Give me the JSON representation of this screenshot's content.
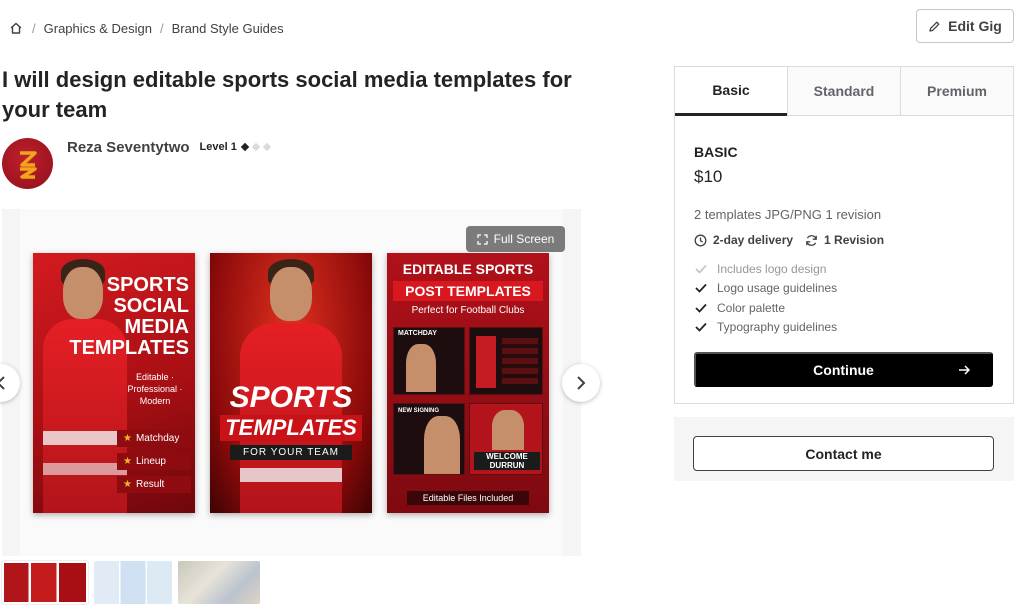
{
  "breadcrumb": {
    "home_icon": "home-icon",
    "items": [
      "Graphics & Design",
      "Brand Style Guides"
    ]
  },
  "actions": {
    "edit_gig": "Edit Gig"
  },
  "gig": {
    "title": "I will design editable sports social media templates for your team"
  },
  "seller": {
    "name": "Reza Seventytwo",
    "level": "Level 1"
  },
  "gallery": {
    "fullscreen_label": "Full Screen",
    "poster1": {
      "headline": [
        "SPORTS",
        "SOCIAL",
        "MEDIA",
        "TEMPLATES"
      ],
      "tagline": "Editable · Professional · Modern",
      "pills": [
        "Matchday",
        "Lineup",
        "Result"
      ]
    },
    "poster2": {
      "line1": "SPORTS",
      "line2": "TEMPLATES",
      "line3": "FOR YOUR TEAM"
    },
    "poster3": {
      "line1": "EDITABLE SPORTS",
      "line2": "POST TEMPLATES",
      "line3": "Perfect for Football Clubs",
      "tiles": [
        "MATCHDAY",
        "NEW SIGNING",
        "WELCOME DURRUN"
      ],
      "footer": "Editable Files Included"
    }
  },
  "package": {
    "tabs": [
      "Basic",
      "Standard",
      "Premium"
    ],
    "active_tab": "Basic",
    "name": "BASIC",
    "price": "$10",
    "description": "2 templates JPG/PNG 1 revision",
    "delivery": "2-day delivery",
    "revisions": "1 Revision",
    "features": [
      {
        "label": "Includes logo design",
        "included": false
      },
      {
        "label": "Logo usage guidelines",
        "included": true
      },
      {
        "label": "Color palette",
        "included": true
      },
      {
        "label": "Typography guidelines",
        "included": true
      }
    ],
    "continue_label": "Continue"
  },
  "contact": {
    "label": "Contact me"
  },
  "colors": {
    "accent": "#000000",
    "brand_red": "#c41c1c",
    "muted": "#62646a"
  }
}
